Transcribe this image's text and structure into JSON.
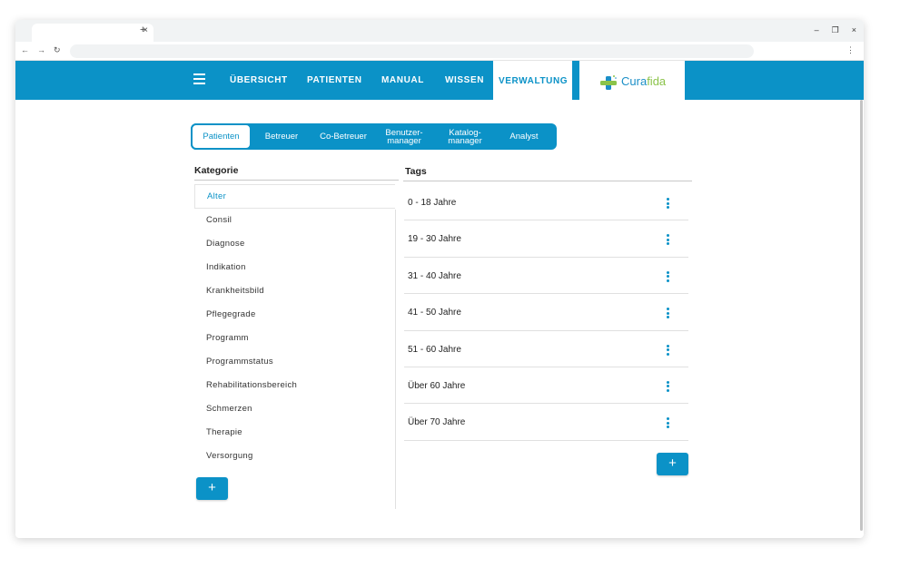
{
  "browser": {
    "tab_close": "×",
    "new_tab": "+",
    "minimize": "–",
    "restore": "❐",
    "close": "×",
    "back": "←",
    "forward": "→",
    "reload": "↻",
    "menu": "⋮"
  },
  "header": {
    "nav": [
      "ÜBERSICHT",
      "PATIENTEN",
      "MANUAL",
      "WISSEN",
      "VERWALTUNG"
    ],
    "active_nav": "VERWALTUNG",
    "logo": {
      "part1": "Cura",
      "part2": "fida"
    }
  },
  "segments": {
    "items": [
      "Patienten",
      "Betreuer",
      "Co-Betreuer",
      "Benutzer-\nmanager",
      "Katalog-\nmanager",
      "Analyst"
    ],
    "active": "Patienten"
  },
  "kategorie": {
    "heading": "Kategorie",
    "items": [
      "Alter",
      "Consil",
      "Diagnose",
      "Indikation",
      "Krankheitsbild",
      "Pflegegrade",
      "Programm",
      "Programmstatus",
      "Rehabilitationsbereich",
      "Schmerzen",
      "Therapie",
      "Versorgung"
    ],
    "active": "Alter",
    "add_label": "+"
  },
  "tags": {
    "heading": "Tags",
    "items": [
      "0 - 18 Jahre",
      "19 - 30 Jahre",
      "31 - 40 Jahre",
      "41 - 50 Jahre",
      "51 - 60 Jahre",
      "Über 60 Jahre",
      "Über 70 Jahre"
    ],
    "add_label": "+"
  },
  "colors": {
    "primary": "#0b92c7",
    "logo_green": "#8bc34a"
  }
}
